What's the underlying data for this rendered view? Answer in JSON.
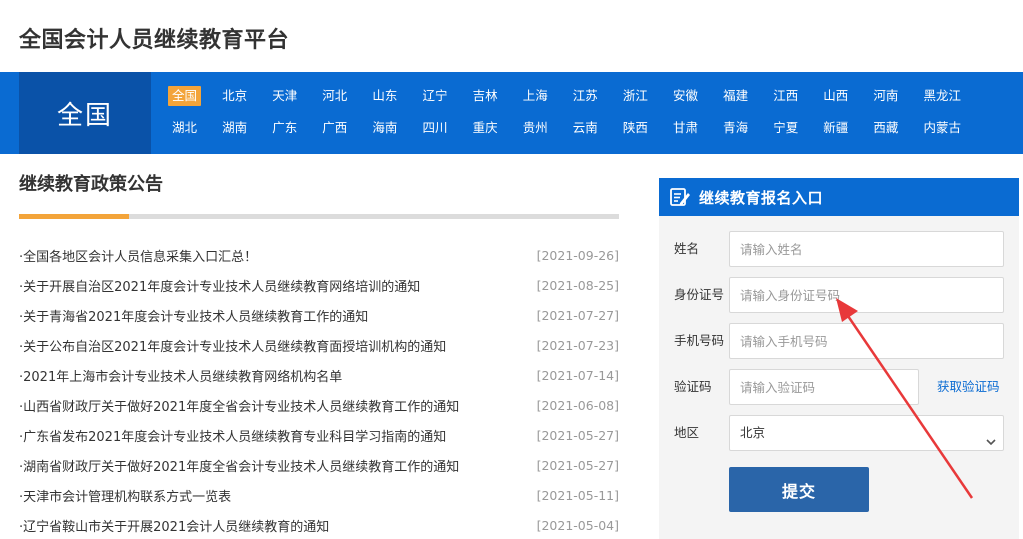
{
  "header": {
    "site_title": "全国会计人员继续教育平台"
  },
  "region_bar": {
    "current_label": "全国",
    "row1": [
      "全国",
      "北京",
      "天津",
      "河北",
      "山东",
      "辽宁",
      "吉林",
      "上海",
      "江苏",
      "浙江",
      "安徽",
      "福建",
      "江西",
      "山西",
      "河南",
      "黑龙江"
    ],
    "row2": [
      "湖北",
      "湖南",
      "广东",
      "广西",
      "海南",
      "四川",
      "重庆",
      "贵州",
      "云南",
      "陕西",
      "甘肃",
      "青海",
      "宁夏",
      "新疆",
      "西藏",
      "内蒙古"
    ],
    "active": "全国",
    "active_color": "#f3a43a"
  },
  "policy": {
    "title": "继续教育政策公告",
    "items": [
      {
        "title": "·全国各地区会计人员信息采集入口汇总！",
        "date": "[2021-09-26]"
      },
      {
        "title": "·关于开展自治区2021年度会计专业技术人员继续教育网络培训的通知",
        "date": "[2021-08-25]"
      },
      {
        "title": "·关于青海省2021年度会计专业技术人员继续教育工作的通知",
        "date": "[2021-07-27]"
      },
      {
        "title": "·关于公布自治区2021年度会计专业技术人员继续教育面授培训机构的通知",
        "date": "[2021-07-23]"
      },
      {
        "title": "·2021年上海市会计专业技术人员继续教育网络机构名单",
        "date": "[2021-07-14]"
      },
      {
        "title": "·山西省财政厅关于做好2021年度全省会计专业技术人员继续教育工作的通知",
        "date": "[2021-06-08]"
      },
      {
        "title": "·广东省发布2021年度会计专业技术人员继续教育专业科目学习指南的通知",
        "date": "[2021-05-27]"
      },
      {
        "title": "·湖南省财政厅关于做好2021年度全省会计专业技术人员继续教育工作的通知",
        "date": "[2021-05-27]"
      },
      {
        "title": "·天津市会计管理机构联系方式一览表",
        "date": "[2021-05-11]"
      },
      {
        "title": "·辽宁省鞍山市关于开展2021会计人员继续教育的通知",
        "date": "[2021-05-04]"
      }
    ]
  },
  "registration": {
    "title": "继续教育报名入口",
    "header_icon": "edit-form-icon",
    "fields": {
      "name": {
        "label": "姓名",
        "placeholder": "请输入姓名"
      },
      "id_number": {
        "label": "身份证号",
        "placeholder": "请输入身份证号码"
      },
      "phone": {
        "label": "手机号码",
        "placeholder": "请输入手机号码"
      },
      "captcha": {
        "label": "验证码",
        "placeholder": "请输入验证码",
        "get_code_label": "获取验证码"
      },
      "region": {
        "label": "地区",
        "selected": "北京"
      }
    },
    "submit_label": "提交"
  },
  "colors": {
    "primary_blue": "#0a6bd2",
    "dark_blue": "#0a52a8",
    "submit_blue": "#2a65a9",
    "accent_orange": "#f3a43a",
    "annotation_red": "#e8393a"
  }
}
